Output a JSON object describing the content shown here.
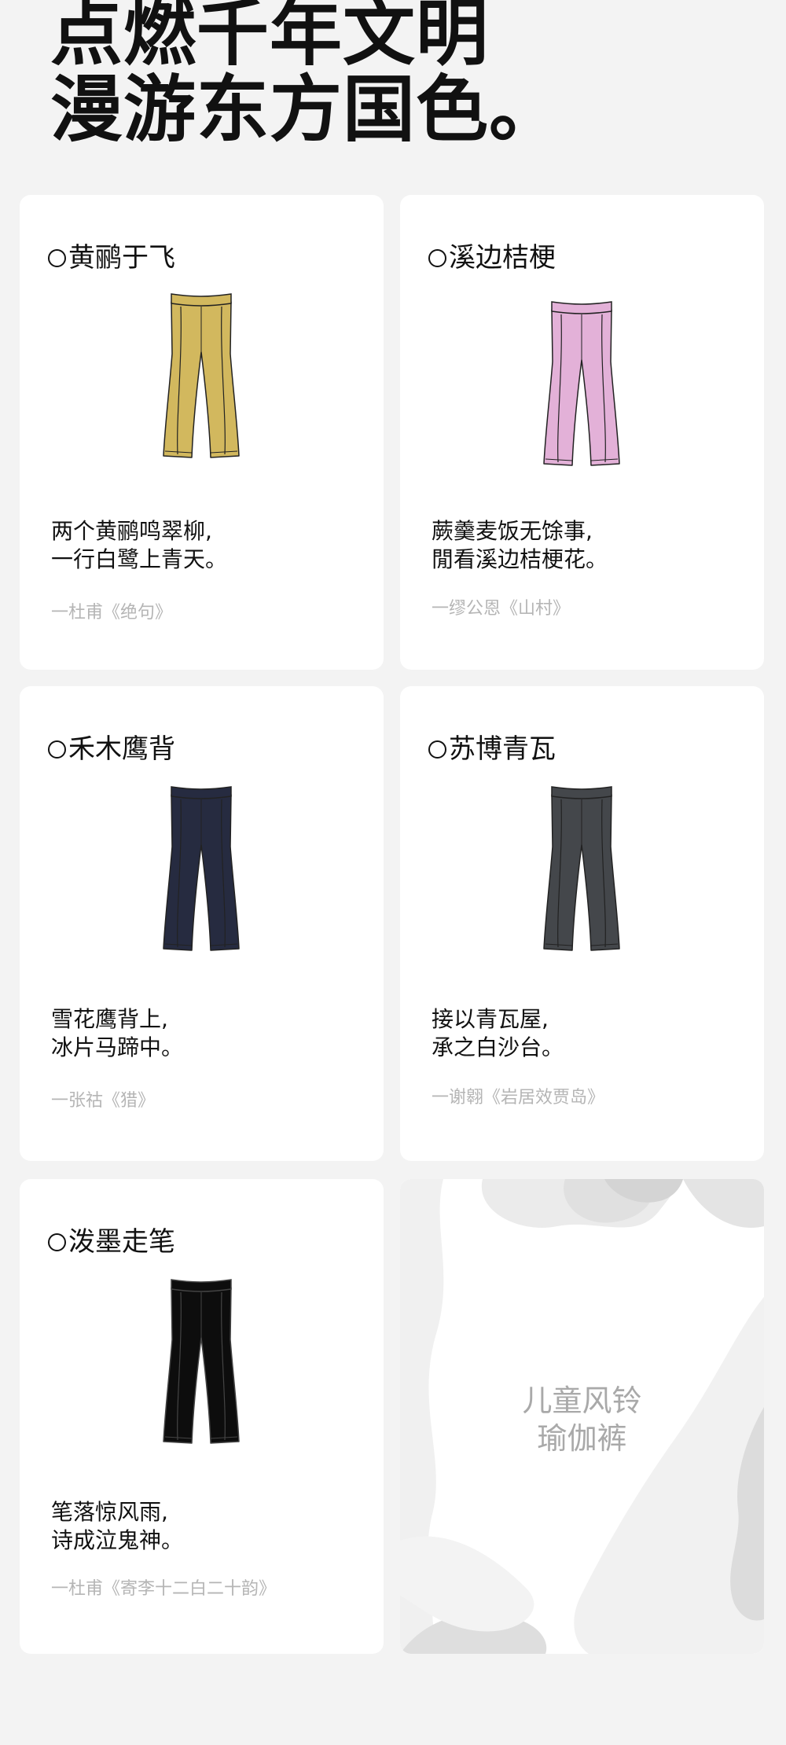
{
  "header": {
    "line1": "点燃千年文明",
    "line2": "漫游东方国色。"
  },
  "cards": [
    {
      "title": "黄鹂于飞",
      "poem_line1": "两个黄鹂鸣翠柳,",
      "poem_line2": "一行白鹭上青天。",
      "cite": "一杜甫《绝句》",
      "color": "#d2b85e",
      "icon": "pants-icon"
    },
    {
      "title": "溪边桔梗",
      "poem_line1": "蕨羹麦饭无馀事,",
      "poem_line2": "閒看溪边桔梗花。",
      "cite": "一缪公恩《山村》",
      "color": "#e3b1d8",
      "icon": "pants-icon"
    },
    {
      "title": "禾木鹰背",
      "poem_line1": "雪花鹰背上,",
      "poem_line2": "冰片马蹄中。",
      "cite": "一张祜《猎》",
      "color": "#262b40",
      "icon": "pants-icon"
    },
    {
      "title": "苏博青瓦",
      "poem_line1": "接以青瓦屋,",
      "poem_line2": "承之白沙台。",
      "cite": "一谢翱《岩居效贾岛》",
      "color": "#44474b",
      "icon": "pants-icon"
    },
    {
      "title": "泼墨走笔",
      "poem_line1": "笔落惊风雨,",
      "poem_line2": "诗成泣鬼神。",
      "cite": "一杜甫《寄李十二白二十韵》",
      "color": "#0d0d0d",
      "icon": "pants-icon"
    }
  ],
  "promo": {
    "line1": "儿童风铃",
    "line2": "瑜伽裤"
  }
}
